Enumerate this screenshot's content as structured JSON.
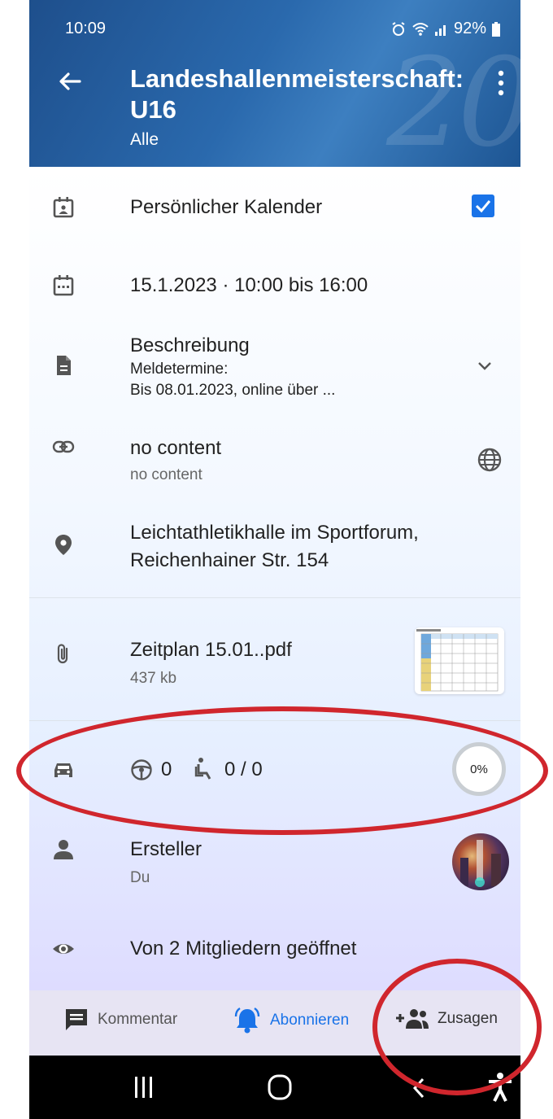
{
  "status": {
    "time": "10:09",
    "battery": "92%"
  },
  "header": {
    "title": "Landeshallenmeisterschaft: U16",
    "title_line1": "Landeshallenmeisterschaft:",
    "title_line2": "U16",
    "subtitle": "Alle"
  },
  "rows": {
    "calendar": {
      "label": "Persönlicher Kalender",
      "checked": true
    },
    "date": {
      "label": "15.1.2023 · 10:00 bis 16:00"
    },
    "description": {
      "label": "Beschreibung",
      "line1": "Meldetermine:",
      "line2": "Bis 08.01.2023, online über ..."
    },
    "link": {
      "label": "no content",
      "sub": "no content"
    },
    "location": {
      "line1": "Leichtathletikhalle im Sportforum,",
      "line2": "Reichenhainer Str. 154"
    },
    "attachment": {
      "name": "Zeitplan 15.01..pdf",
      "size": "437 kb"
    },
    "rides": {
      "drivers": "0",
      "seats": "0 / 0",
      "percent": "0%"
    },
    "creator": {
      "label": "Ersteller",
      "sub": "Du"
    },
    "views": {
      "label": "Von 2 Mitgliedern geöffnet"
    }
  },
  "actions": {
    "comment": "Kommentar",
    "subscribe": "Abonnieren",
    "accept": "Zusagen"
  },
  "colors": {
    "header": "#2a69ad",
    "accent": "#1a73e8",
    "annotation": "#d0262d"
  }
}
